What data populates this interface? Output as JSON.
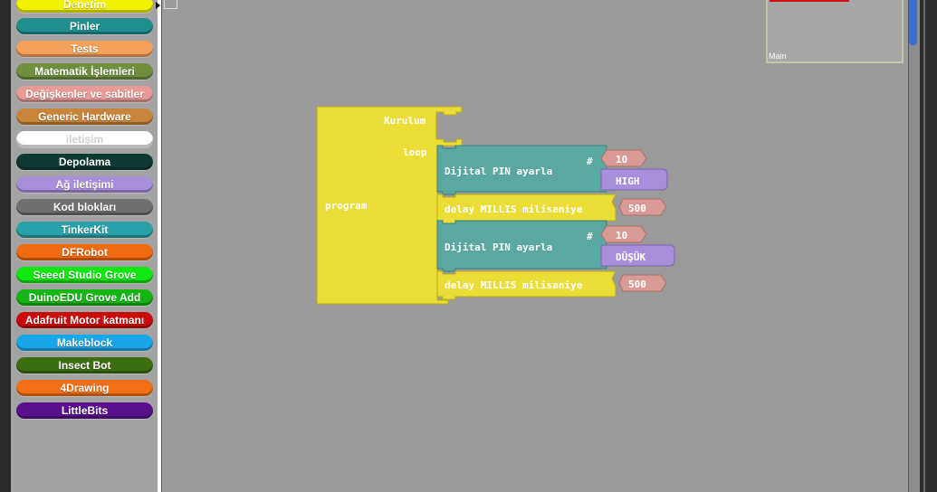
{
  "palette": {
    "categories": [
      {
        "label": "Denetim",
        "color": "#f2f200"
      },
      {
        "label": "Pinler",
        "color": "#1f8f8f"
      },
      {
        "label": "Tests",
        "color": "#f5a05a"
      },
      {
        "label": "Matematik İşlemleri",
        "color": "#6f8f3f"
      },
      {
        "label": "Değişkenler ve sabitler",
        "color": "#e79a96"
      },
      {
        "label": "Generic Hardware",
        "color": "#c8843a"
      },
      {
        "label": "iletişim",
        "color": "#ffffff"
      },
      {
        "label": "Depolama",
        "color": "#0e3a34"
      },
      {
        "label": "Ağ iletişimi",
        "color": "#a98fdb"
      },
      {
        "label": "Kod blokları",
        "color": "#707070"
      },
      {
        "label": "TinkerKit",
        "color": "#2aa0a8"
      },
      {
        "label": "DFRobot",
        "color": "#f06a10"
      },
      {
        "label": "Seeed Studio Grove",
        "color": "#11e611"
      },
      {
        "label": "DuinoEDU Grove Add",
        "color": "#15b515"
      },
      {
        "label": "Adafruit Motor katmanı",
        "color": "#c90a0a"
      },
      {
        "label": "Makeblock",
        "color": "#19a6e6"
      },
      {
        "label": "Insect Bot",
        "color": "#3c6e10"
      },
      {
        "label": "4Drawing",
        "color": "#f27013"
      },
      {
        "label": "LittleBits",
        "color": "#5a108a"
      }
    ]
  },
  "minimap": {
    "label": "Main"
  },
  "program": {
    "label": "program",
    "setup_label": "Kurulum",
    "loop_label": "loop",
    "color": "#ecdd36",
    "statements": [
      {
        "kind": "digital",
        "label": "Dijital PIN ayarla",
        "hash": "#",
        "pin": "10",
        "value": "HIGH"
      },
      {
        "kind": "delay",
        "label": "delay MILLIS milisaniye",
        "value": "500"
      },
      {
        "kind": "digital",
        "label": "Dijital PIN ayarla",
        "hash": "#",
        "pin": "10",
        "value": "DÜŞÜK"
      },
      {
        "kind": "delay",
        "label": "delay MILLIS milisaniye",
        "value": "500"
      }
    ]
  },
  "colors": {
    "pins_block": "#5aa8a0",
    "delay_block": "#ecdd36",
    "number_block": "#d99a96",
    "state_block": "#a98fdb"
  },
  "icons": {
    "palette_cursor": "triangle-arrow"
  }
}
